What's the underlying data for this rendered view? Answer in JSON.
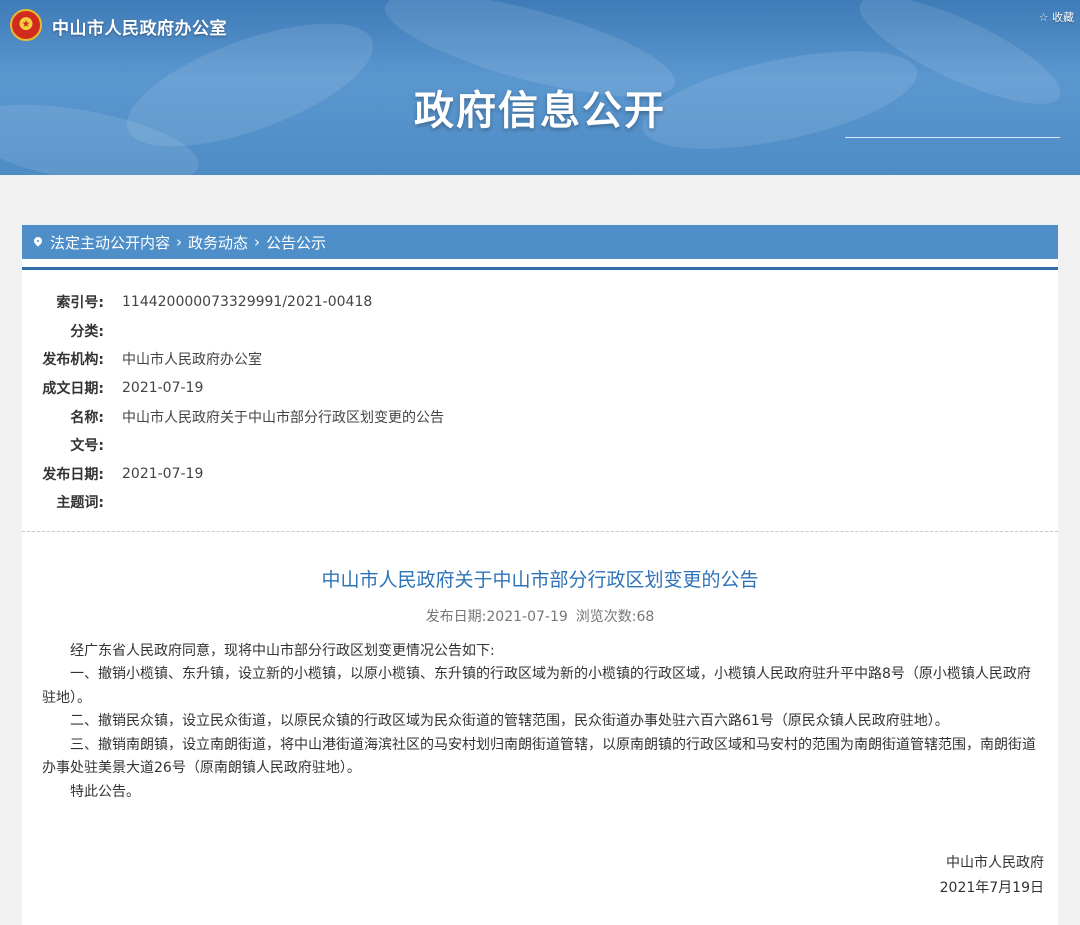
{
  "header": {
    "site_title": "中山市人民政府办公室",
    "favorite_label": "☆ 收藏",
    "banner_title": "政府信息公开"
  },
  "breadcrumb": [
    {
      "label": "法定主动公开内容"
    },
    {
      "label": "政务动态"
    },
    {
      "label": "公告公示"
    }
  ],
  "meta": [
    {
      "label": "索引号:",
      "value": "114420000073329991/2021-00418"
    },
    {
      "label": "分类:",
      "value": ""
    },
    {
      "label": "发布机构:",
      "value": "中山市人民政府办公室"
    },
    {
      "label": "成文日期:",
      "value": "2021-07-19"
    },
    {
      "label": "名称:",
      "value": "中山市人民政府关于中山市部分行政区划变更的公告"
    },
    {
      "label": "文号:",
      "value": ""
    },
    {
      "label": "发布日期:",
      "value": "2021-07-19"
    },
    {
      "label": "主题词:",
      "value": ""
    }
  ],
  "article": {
    "title": "中山市人民政府关于中山市部分行政区划变更的公告",
    "publish_date_label": "发布日期:",
    "publish_date": "2021-07-19",
    "views_label": "浏览次数:",
    "views": "68",
    "paragraphs": [
      "经广东省人民政府同意，现将中山市部分行政区划变更情况公告如下:",
      "一、撤销小榄镇、东升镇，设立新的小榄镇，以原小榄镇、东升镇的行政区域为新的小榄镇的行政区域，小榄镇人民政府驻升平中路8号（原小榄镇人民政府驻地）。",
      "二、撤销民众镇，设立民众街道，以原民众镇的行政区域为民众街道的管辖范围，民众街道办事处驻六百六路61号（原民众镇人民政府驻地）。",
      "三、撤销南朗镇，设立南朗街道，将中山港街道海滨社区的马安村划归南朗街道管辖，以原南朗镇的行政区域和马安村的范围为南朗街道管辖范围，南朗街道办事处驻美景大道26号（原南朗镇人民政府驻地）。",
      "特此公告。"
    ],
    "signature": "中山市人民政府",
    "sign_date": "2021年7月19日"
  }
}
